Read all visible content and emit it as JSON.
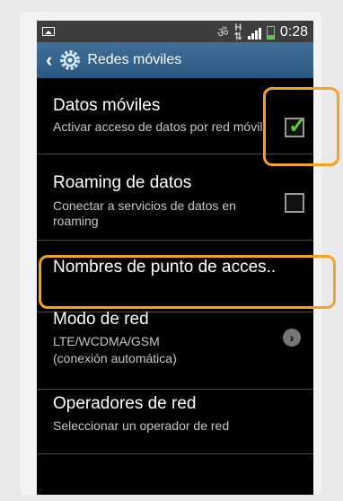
{
  "status_bar": {
    "time": "0:28",
    "network": "H"
  },
  "action_bar": {
    "title": "Redes móviles"
  },
  "settings": [
    {
      "title": "Datos móviles",
      "summary": "Activar acceso de datos por red móvil",
      "checked": true
    },
    {
      "title": "Roaming de datos",
      "summary": "Conectar a servicios de datos en roaming",
      "checked": false
    },
    {
      "title": "Nombres de punto de acces.."
    },
    {
      "title": "Modo de red",
      "summary_line1": "LTE/WCDMA/GSM",
      "summary_line2": "(conexión automática)"
    },
    {
      "title": "Operadores de red",
      "summary": "Seleccionar un operador de red"
    }
  ],
  "colors": {
    "highlight": "#f5a31a",
    "check": "#5fcf2e",
    "action_bar": "#2a587f"
  }
}
